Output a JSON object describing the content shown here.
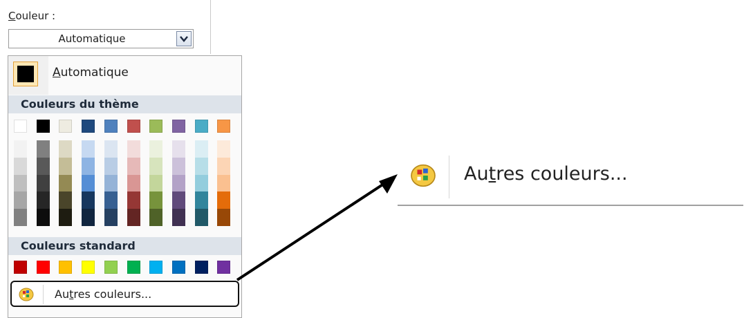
{
  "couleur": {
    "label": "Couleur :",
    "underlined_char": "C",
    "label_rest": "ouleur :",
    "value": "Automatique"
  },
  "dropdown": {
    "automatic": {
      "underlined_char": "A",
      "label_rest": "utomatique",
      "color": "#000000"
    },
    "theme_header": "Couleurs du thème",
    "theme_colors": [
      {
        "base": "#ffffff",
        "tints": [
          "#f2f2f2",
          "#d9d9d9",
          "#bfbfbf",
          "#a6a6a6",
          "#808080"
        ]
      },
      {
        "base": "#000000",
        "tints": [
          "#808080",
          "#595959",
          "#404040",
          "#262626",
          "#0d0d0d"
        ]
      },
      {
        "base": "#eeece1",
        "tints": [
          "#ddd9c4",
          "#c4bd97",
          "#948a54",
          "#4a452a",
          "#1e1c11"
        ]
      },
      {
        "base": "#1f497d",
        "tints": [
          "#c6d9f1",
          "#8eb4e3",
          "#558ed5",
          "#17375e",
          "#10253f"
        ]
      },
      {
        "base": "#4f81bd",
        "tints": [
          "#dbe5f1",
          "#b9cde5",
          "#95b3d7",
          "#376092",
          "#254061"
        ]
      },
      {
        "base": "#c0504d",
        "tints": [
          "#f2dcdb",
          "#e6b9b8",
          "#d99694",
          "#953735",
          "#632523"
        ]
      },
      {
        "base": "#9bbb59",
        "tints": [
          "#ebf1de",
          "#d7e4bd",
          "#c3d69b",
          "#77933c",
          "#4f6228"
        ]
      },
      {
        "base": "#8064a2",
        "tints": [
          "#e6e0ec",
          "#ccc1da",
          "#b3a2c7",
          "#604a7b",
          "#403152"
        ]
      },
      {
        "base": "#4bacc6",
        "tints": [
          "#dbeef4",
          "#b7dee8",
          "#93cddd",
          "#31859c",
          "#215968"
        ]
      },
      {
        "base": "#f79646",
        "tints": [
          "#fdeada",
          "#fcd5b5",
          "#fac090",
          "#e46c0a",
          "#984807"
        ]
      }
    ],
    "standard_header": "Couleurs standard",
    "standard_colors": [
      "#c00000",
      "#ff0000",
      "#ffc000",
      "#ffff00",
      "#92d050",
      "#00b050",
      "#00b0f0",
      "#0070c0",
      "#002060",
      "#7030a0"
    ],
    "autres": {
      "before": "Au",
      "underlined_char": "t",
      "after": "res couleurs..."
    }
  },
  "zoom": {
    "before": "Au",
    "underlined_char": "t",
    "after": "res couleurs..."
  }
}
